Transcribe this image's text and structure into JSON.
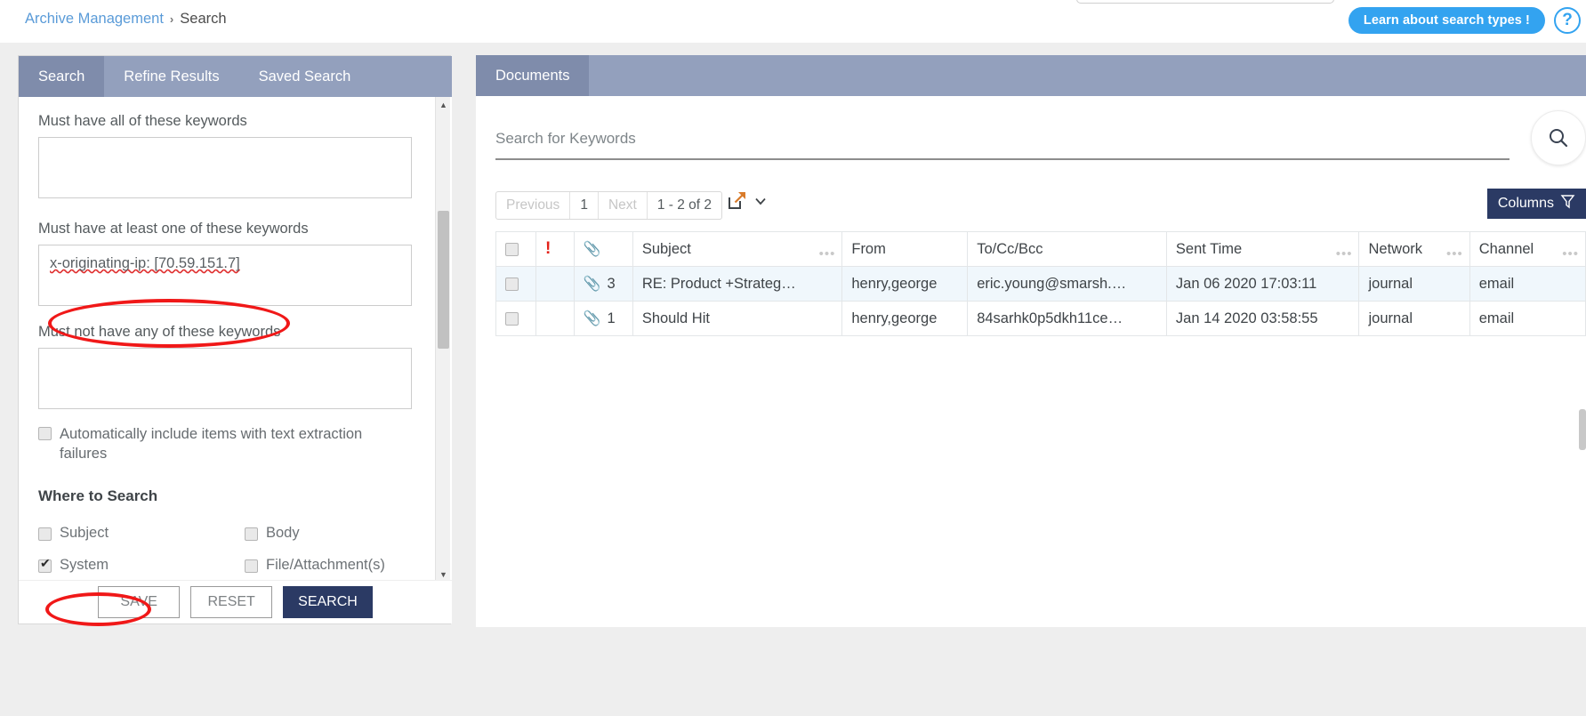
{
  "breadcrumb": {
    "root": "Archive Management",
    "separator": "›",
    "current": "Search"
  },
  "header": {
    "learn_button": "Learn about search types !",
    "help_icon_label": "?",
    "accent_blue": "#33a3f0"
  },
  "left_panel": {
    "tabs": [
      {
        "label": "Search",
        "active": true
      },
      {
        "label": "Refine Results",
        "active": false
      },
      {
        "label": "Saved Search",
        "active": false
      }
    ],
    "fields": [
      {
        "label": "Must have all of these keywords",
        "value": ""
      },
      {
        "label": "Must have at least one of these keywords",
        "value": "x-originating-ip: [70.59.151.7]",
        "spellcheck_word": "x-originating-ip"
      },
      {
        "label": "Must not have any of these keywords",
        "value": ""
      }
    ],
    "text_extraction": {
      "label": "Automatically include items with text extraction failures",
      "checked": false
    },
    "where_to_search": {
      "title": "Where to Search",
      "options": [
        {
          "label": "Subject",
          "checked": false
        },
        {
          "label": "Body",
          "checked": false
        },
        {
          "label": "System",
          "checked": true
        },
        {
          "label": "File/Attachment(s)",
          "checked": false
        }
      ]
    },
    "buttons": {
      "save": "SAVE",
      "reset": "RESET",
      "search": "SEARCH",
      "primary_color": "#2b3a64"
    }
  },
  "right_panel": {
    "tabs": [
      {
        "label": "Documents",
        "active": true
      }
    ],
    "search": {
      "placeholder": "Search for Keywords",
      "value": "",
      "icon": "search-icon"
    },
    "pager": {
      "previous": "Previous",
      "page": "1",
      "next": "Next",
      "range": "1 - 2 of 2"
    },
    "export": {
      "icon": "export-icon",
      "chevron": "chevron-down-icon"
    },
    "columns_button": {
      "label": "Columns",
      "icon": "filter-funnel-icon"
    },
    "table": {
      "columns": [
        {
          "key": "select",
          "label": "",
          "icon": "checkbox-icon",
          "menu": false
        },
        {
          "key": "priority",
          "label": "",
          "icon": "exclamation-icon",
          "menu": false
        },
        {
          "key": "attachments",
          "label": "",
          "icon": "paperclip-icon",
          "menu": false
        },
        {
          "key": "subject",
          "label": "Subject",
          "menu": true
        },
        {
          "key": "from",
          "label": "From",
          "menu": false
        },
        {
          "key": "toccbcc",
          "label": "To/Cc/Bcc",
          "menu": false
        },
        {
          "key": "sent_time",
          "label": "Sent Time",
          "menu": true
        },
        {
          "key": "network",
          "label": "Network",
          "menu": true
        },
        {
          "key": "channel",
          "label": "Channel",
          "menu": true
        }
      ],
      "rows": [
        {
          "selected": false,
          "highlighted": true,
          "attachment_count": "3",
          "subject": "RE: Product +Strateg…",
          "from": "henry,george",
          "toccbcc": "eric.young@smarsh.…",
          "sent_time": "Jan 06 2020 17:03:11",
          "network": "journal",
          "channel": "email"
        },
        {
          "selected": false,
          "highlighted": false,
          "attachment_count": "1",
          "subject": "Should Hit",
          "from": "henry,george",
          "toccbcc": "84sarhk0p5dkh11ce…",
          "sent_time": "Jan 14 2020 03:58:55",
          "network": "journal",
          "channel": "email"
        }
      ]
    }
  },
  "annotations": [
    {
      "name": "keyword-highlight",
      "color": "#f01818",
      "shape": "ellipse"
    },
    {
      "name": "system-checkbox-highlight",
      "color": "#f01818",
      "shape": "ellipse"
    }
  ]
}
